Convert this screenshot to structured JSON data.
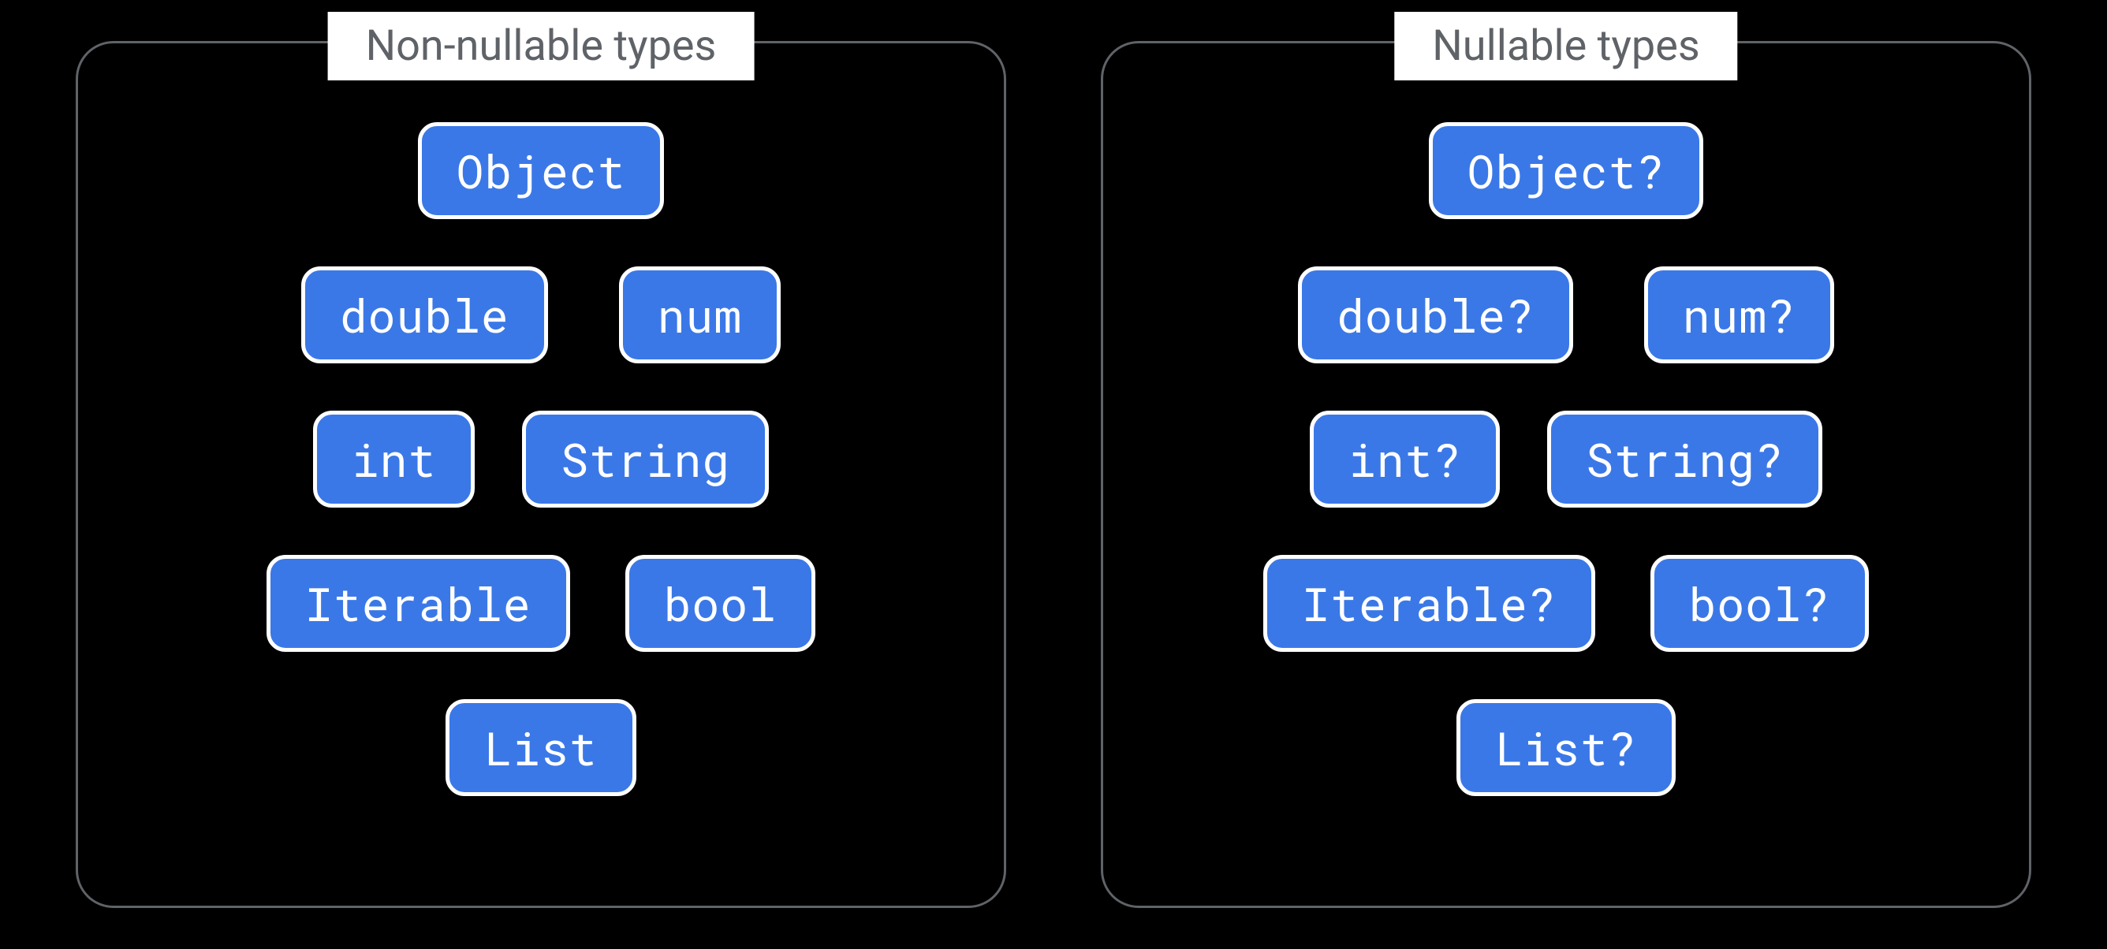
{
  "panels": [
    {
      "title": "Non-nullable types",
      "rows": [
        [
          "Object"
        ],
        [
          "double",
          "num"
        ],
        [
          "int",
          "String"
        ],
        [
          "Iterable",
          "bool"
        ],
        [
          "List"
        ]
      ]
    },
    {
      "title": "Nullable types",
      "rows": [
        [
          "Object?"
        ],
        [
          "double?",
          "num?"
        ],
        [
          "int?",
          "String?"
        ],
        [
          "Iterable?",
          "bool?"
        ],
        [
          "List?"
        ]
      ]
    }
  ]
}
